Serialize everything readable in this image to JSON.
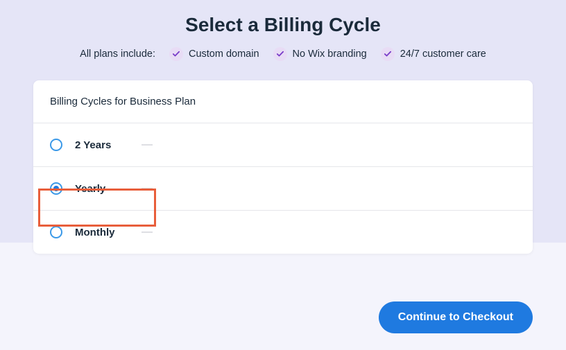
{
  "header": {
    "title": "Select a Billing Cycle",
    "features_intro": "All plans include:",
    "features": [
      "Custom domain",
      "No Wix branding",
      "24/7 customer care"
    ]
  },
  "card": {
    "title": "Billing Cycles for Business Plan",
    "options": [
      {
        "label": "2 Years",
        "selected": false
      },
      {
        "label": "Yearly",
        "selected": true
      },
      {
        "label": "Monthly",
        "selected": false
      }
    ]
  },
  "actions": {
    "continue_label": "Continue to Checkout"
  }
}
